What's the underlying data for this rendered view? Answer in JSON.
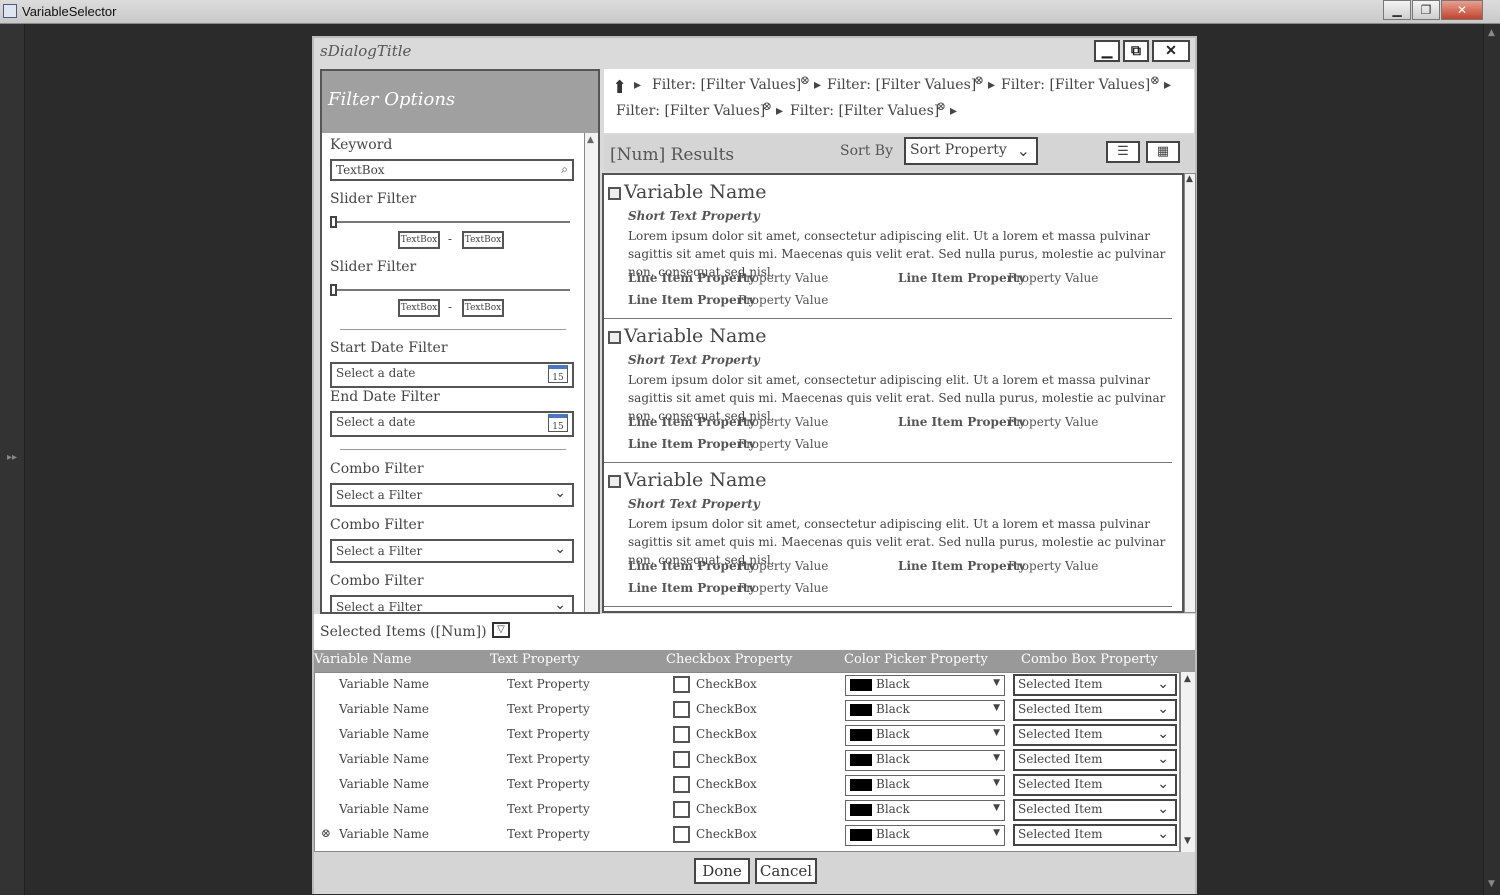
{
  "window": {
    "title": "VariableSelector",
    "minimize": "▁",
    "maximize": "❐",
    "close": "✕"
  },
  "strip": {
    "expand": "▸▸"
  },
  "dialog": {
    "title": "sDialogTitle",
    "controls": {
      "minimize": "▁",
      "restore": "⧉",
      "close": "✕"
    },
    "filter_panel": {
      "title": "Filter Options",
      "keyword": {
        "label": "Keyword",
        "value": "TextBox"
      },
      "sliders": [
        {
          "label": "Slider Filter",
          "min": "TextBox",
          "max": "TextBox",
          "sep": "-"
        },
        {
          "label": "Slider Filter",
          "min": "TextBox",
          "max": "TextBox",
          "sep": "-"
        }
      ],
      "start_date": {
        "label": "Start Date Filter",
        "placeholder": "Select a date",
        "cal": "15"
      },
      "end_date": {
        "label": "End Date Filter",
        "placeholder": "Select a date",
        "cal": "15"
      },
      "combos": [
        {
          "label": "Combo Filter",
          "placeholder": "Select a Filter"
        },
        {
          "label": "Combo Filter",
          "placeholder": "Select a Filter"
        },
        {
          "label": "Combo Filter",
          "placeholder": "Select a Filter"
        }
      ]
    },
    "breadcrumb": {
      "row1": [
        "Filter: [Filter Values]",
        "Filter: [Filter Values]",
        "Filter: [Filter Values]"
      ],
      "row2": [
        "Filter: [Filter Values]",
        "Filter: [Filter Values]"
      ],
      "remove": "⊗",
      "arrow": "▸",
      "home": "⬆"
    },
    "results_bar": {
      "count": "[Num] Results",
      "sort_label": "Sort By",
      "sort_value": "Sort Property",
      "chev": "⌄",
      "list_view": "☰",
      "grid_view": "▦"
    },
    "results": [
      {
        "name": "Variable Name",
        "short": "Short Text Property",
        "desc": "Lorem ipsum dolor sit amet, consectetur adipiscing elit. Ut a lorem et massa pulvinar sagittis sit amet quis mi. Maecenas quis velit erat. Sed nulla purus, molestie ac pulvinar non, consequat sed nisl.",
        "props": [
          {
            "k": "Line Item Property",
            "v": "Property Value"
          },
          {
            "k": "Line Item Property",
            "v": "Property Value"
          },
          {
            "k": "Line Item Property",
            "v": "Property Value"
          }
        ]
      },
      {
        "name": "Variable Name",
        "short": "Short Text Property",
        "desc": "Lorem ipsum dolor sit amet, consectetur adipiscing elit. Ut a lorem et massa pulvinar sagittis sit amet quis mi. Maecenas quis velit erat. Sed nulla purus, molestie ac pulvinar non, consequat sed nisl.",
        "props": [
          {
            "k": "Line Item Property",
            "v": "Property Value"
          },
          {
            "k": "Line Item Property",
            "v": "Property Value"
          },
          {
            "k": "Line Item Property",
            "v": "Property Value"
          }
        ]
      },
      {
        "name": "Variable Name",
        "short": "Short Text Property",
        "desc": "Lorem ipsum dolor sit amet, consectetur adipiscing elit. Ut a lorem et massa pulvinar sagittis sit amet quis mi. Maecenas quis velit erat. Sed nulla purus, molestie ac pulvinar non, consequat sed nisl.",
        "props": [
          {
            "k": "Line Item Property",
            "v": "Property Value"
          },
          {
            "k": "Line Item Property",
            "v": "Property Value"
          },
          {
            "k": "Line Item Property",
            "v": "Property Value"
          }
        ]
      }
    ],
    "selected": {
      "label": "Selected Items ([Num])",
      "filter_icon": "▽",
      "columns": [
        "Variable Name",
        "Text Property",
        "Checkbox Property",
        "Color Picker Property",
        "Combo Box Property"
      ],
      "rows": [
        {
          "name": "Variable Name",
          "text": "Text Property",
          "cb": "CheckBox",
          "color": "Black",
          "combo": "Selected Item"
        },
        {
          "name": "Variable Name",
          "text": "Text Property",
          "cb": "CheckBox",
          "color": "Black",
          "combo": "Selected Item"
        },
        {
          "name": "Variable Name",
          "text": "Text Property",
          "cb": "CheckBox",
          "color": "Black",
          "combo": "Selected Item"
        },
        {
          "name": "Variable Name",
          "text": "Text Property",
          "cb": "CheckBox",
          "color": "Black",
          "combo": "Selected Item"
        },
        {
          "name": "Variable Name",
          "text": "Text Property",
          "cb": "CheckBox",
          "color": "Black",
          "combo": "Selected Item"
        },
        {
          "name": "Variable Name",
          "text": "Text Property",
          "cb": "CheckBox",
          "color": "Black",
          "combo": "Selected Item"
        },
        {
          "name": "Variable Name",
          "text": "Text Property",
          "cb": "CheckBox",
          "color": "Black",
          "combo": "Selected Item"
        }
      ],
      "row_remove": "⊗",
      "dd_arrow": "▼",
      "chev": "⌄"
    },
    "footer": {
      "done": "Done",
      "cancel": "Cancel"
    }
  },
  "colors": {
    "header_gray": "#a0a0a0",
    "panel_border": "#555555",
    "swatch": "#000000"
  }
}
